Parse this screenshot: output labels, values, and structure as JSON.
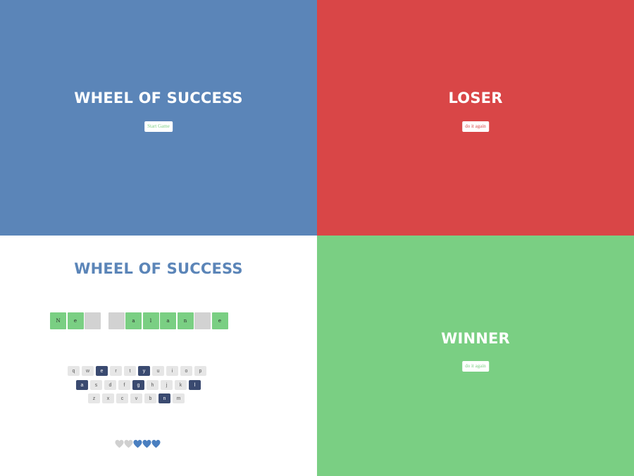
{
  "start_screen": {
    "title": "WHEEL OF SUCCESS",
    "button_label": "Start Game",
    "background_color": "#5b85b8"
  },
  "lose_screen": {
    "title": "LOSER",
    "button_label": "do it again",
    "background_color": "#d94647"
  },
  "win_screen": {
    "title": "WINNER",
    "button_label": "do it again",
    "background_color": "#7acf83"
  },
  "game_screen": {
    "title": "WHEEL OF SUCCESS",
    "phrase": [
      {
        "char": "N",
        "revealed": true
      },
      {
        "char": "e",
        "revealed": true
      },
      {
        "char": "",
        "revealed": false
      },
      {
        "char": "",
        "space": true
      },
      {
        "char": "",
        "revealed": false
      },
      {
        "char": "a",
        "revealed": true
      },
      {
        "char": "l",
        "revealed": true
      },
      {
        "char": "a",
        "revealed": true
      },
      {
        "char": "n",
        "revealed": true
      },
      {
        "char": "",
        "revealed": false
      },
      {
        "char": "e",
        "revealed": true
      }
    ],
    "keyboard": [
      [
        {
          "key": "q",
          "chosen": false
        },
        {
          "key": "w",
          "chosen": false
        },
        {
          "key": "e",
          "chosen": true
        },
        {
          "key": "r",
          "chosen": false
        },
        {
          "key": "t",
          "chosen": false
        },
        {
          "key": "y",
          "chosen": true
        },
        {
          "key": "u",
          "chosen": false
        },
        {
          "key": "i",
          "chosen": false
        },
        {
          "key": "o",
          "chosen": false
        },
        {
          "key": "p",
          "chosen": false
        }
      ],
      [
        {
          "key": "a",
          "chosen": true
        },
        {
          "key": "s",
          "chosen": false
        },
        {
          "key": "d",
          "chosen": false
        },
        {
          "key": "f",
          "chosen": false
        },
        {
          "key": "g",
          "chosen": true
        },
        {
          "key": "h",
          "chosen": false
        },
        {
          "key": "j",
          "chosen": false
        },
        {
          "key": "k",
          "chosen": false
        },
        {
          "key": "l",
          "chosen": true
        }
      ],
      [
        {
          "key": "z",
          "chosen": false
        },
        {
          "key": "x",
          "chosen": false
        },
        {
          "key": "c",
          "chosen": false
        },
        {
          "key": "v",
          "chosen": false
        },
        {
          "key": "b",
          "chosen": false
        },
        {
          "key": "n",
          "chosen": true
        },
        {
          "key": "m",
          "chosen": false
        }
      ]
    ],
    "hearts": {
      "total": 5,
      "lost": 2,
      "full_color": "#4a7fc0",
      "lost_color": "#d0d0d0"
    },
    "colors": {
      "revealed_tile": "#7acf83",
      "hidden_tile": "#d2d2d2",
      "chosen_key": "#3a4a70",
      "key": "#e6e6e6"
    }
  }
}
